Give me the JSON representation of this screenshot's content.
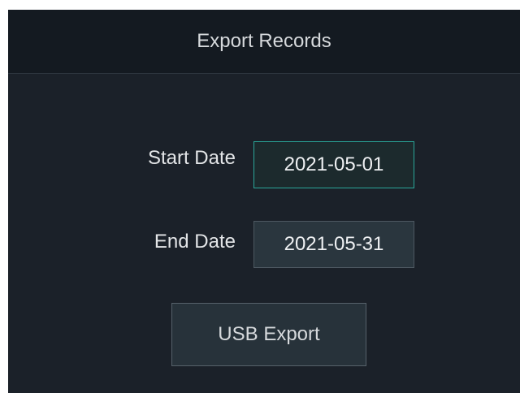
{
  "header": {
    "title": "Export Records"
  },
  "form": {
    "start_date_label": "Start Date",
    "start_date_value": "2021-05-01",
    "end_date_label": "End Date",
    "end_date_value": "2021-05-31"
  },
  "actions": {
    "usb_export_label": "USB Export"
  },
  "colors": {
    "background": "#1b2129",
    "header_background": "#141a21",
    "accent": "#2aa79a"
  }
}
